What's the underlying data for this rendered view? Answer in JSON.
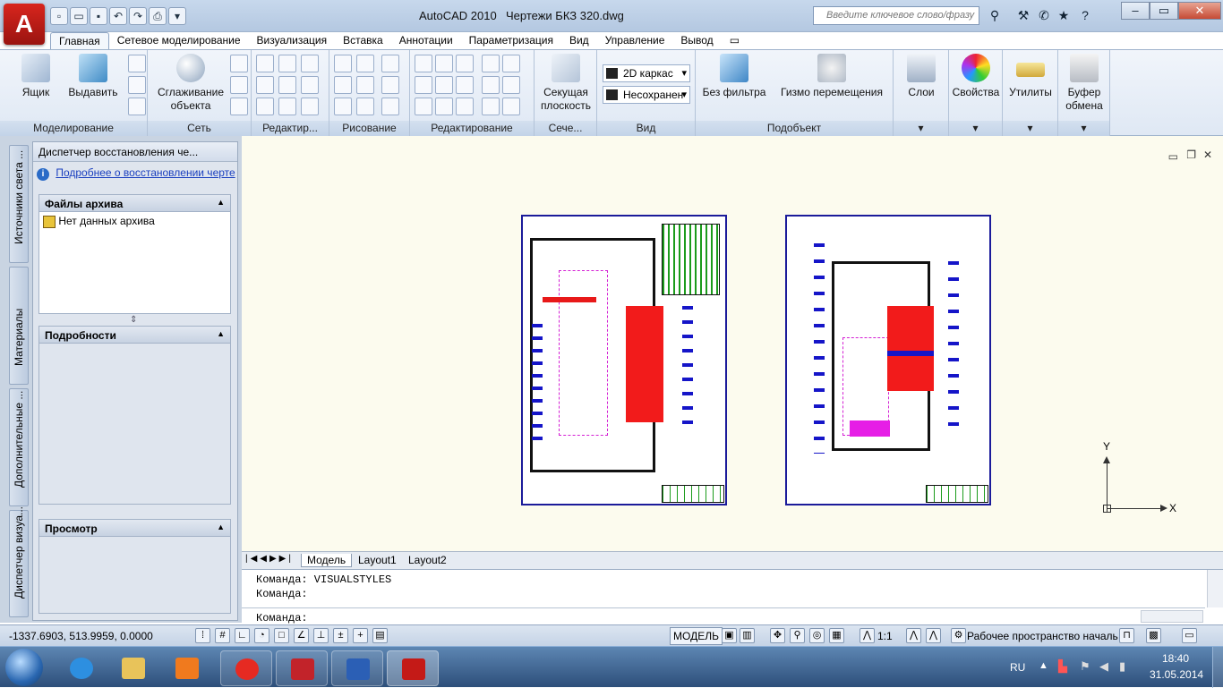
{
  "app": {
    "name": "AutoCAD 2010",
    "file": "Чертежи БКЗ 320.dwg",
    "logo": "A"
  },
  "search": {
    "placeholder": "Введите ключевое слово/фразу"
  },
  "tabs": [
    "Главная",
    "Сетевое моделирование",
    "Визуализация",
    "Вставка",
    "Аннотации",
    "Параметризация",
    "Вид",
    "Управление",
    "Вывод"
  ],
  "ribbon": {
    "box": "Ящик",
    "extrude": "Выдавить",
    "smooth": [
      "Сглаживание",
      "объекта"
    ],
    "section": [
      "Секущая",
      "плоскость"
    ],
    "visual_style": "2D каркас",
    "unsaved": "Несохранен",
    "no_filter": "Без фильтра",
    "gizmo": "Гизмо перемещения",
    "layers": "Слои",
    "properties": "Свойства",
    "utilities": "Утилиты",
    "clipboard": [
      "Буфер",
      "обмена"
    ],
    "panels": [
      "Моделирование",
      "Сеть",
      "Редактир...",
      "Рисование",
      "Редактирование",
      "Сече...",
      "Вид",
      "Подобъект"
    ]
  },
  "sidebar": {
    "vtabs": [
      "Источники света ...",
      "Материалы",
      "Дополнительные ...",
      "Диспетчер визуа..."
    ],
    "palette_title": "Диспетчер восстановления че...",
    "link": "Подробнее о восстановлении черте",
    "archive_head": "Файлы архива",
    "no_archive": "Нет данных архива",
    "details_head": "Подробности",
    "preview_head": "Просмотр"
  },
  "layout_tabs": [
    "Модель",
    "Layout1",
    "Layout2"
  ],
  "command": {
    "lines": [
      "Команда: VISUALSTYLES",
      "Команда:"
    ],
    "prompt": "Команда:"
  },
  "ucs": {
    "x": "X",
    "y": "Y"
  },
  "status": {
    "coords": "-1337.6903, 513.9959, 0.0000",
    "model": "МОДЕЛЬ",
    "scale": "1:1",
    "workspace": "Рабочее пространство началь"
  },
  "taskbar": {
    "lang": "RU",
    "time": "18:40",
    "date": "31.05.2014"
  }
}
